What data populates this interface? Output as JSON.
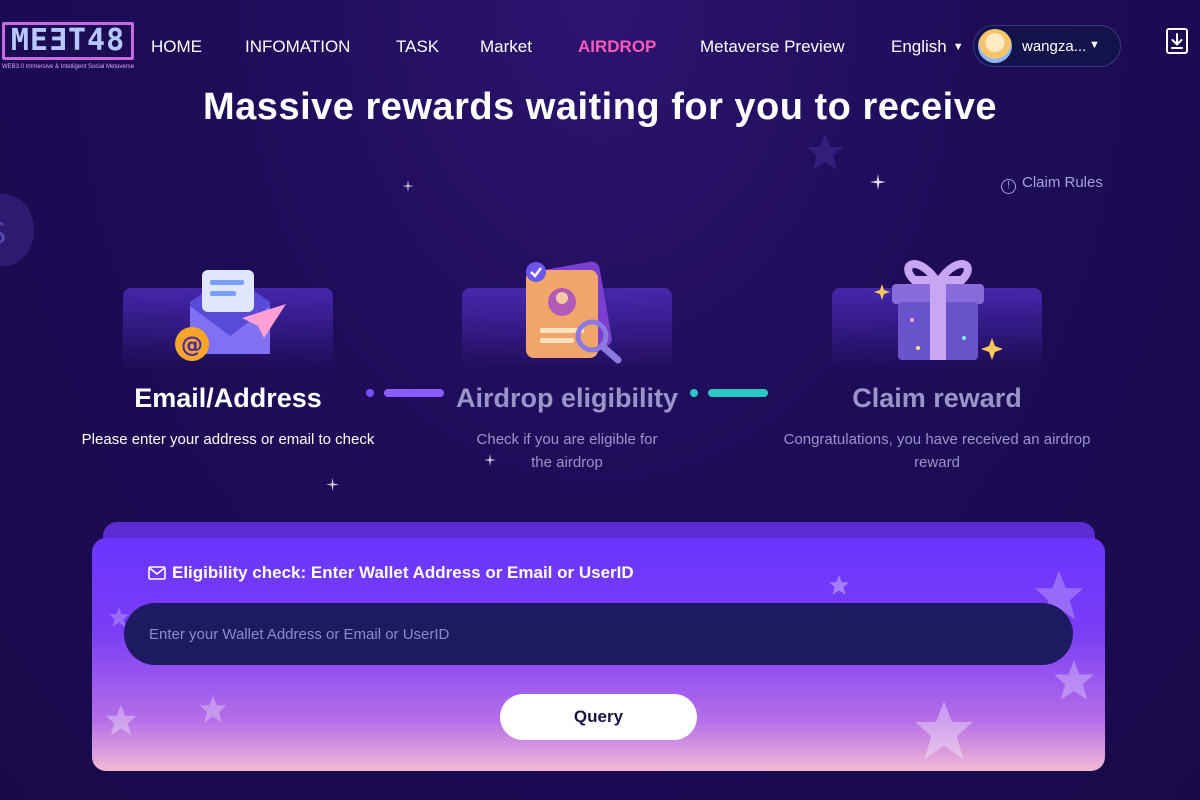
{
  "header": {
    "logo_text": "MEƎT48",
    "logo_tagline": "WEB3.0 Immersive & Intelligent Social Metaverse",
    "nav": [
      {
        "label": "HOME"
      },
      {
        "label": "INFOMATION"
      },
      {
        "label": "TASK"
      },
      {
        "label": "Market"
      },
      {
        "label": "AIRDROP",
        "active": true
      },
      {
        "label": "Metaverse Preview"
      }
    ],
    "language": "English",
    "username": "wangza..."
  },
  "hero": {
    "title": "Massive rewards waiting for you to receive",
    "claim_rules": "Claim Rules"
  },
  "steps": [
    {
      "title": "Email/Address",
      "desc": "Please enter your address or email to check",
      "active": true
    },
    {
      "title": "Airdrop eligibility",
      "desc": "Check if you are eligible for the airdrop",
      "active": false
    },
    {
      "title": "Claim reward",
      "desc": "Congratulations, you have received an airdrop reward",
      "active": false
    }
  ],
  "query": {
    "label": "Eligibility check: Enter Wallet Address or Email or UserID",
    "placeholder": "Enter your Wallet Address or Email or UserID",
    "value": "",
    "button": "Query"
  },
  "colors": {
    "accent_pink": "#ff5ab9",
    "bg_dark": "#1e0c58",
    "card_purple": "#6a36ff",
    "connector_purple": "#8a5cff",
    "connector_teal": "#2cc7c4",
    "inactive_text": "#9a94c8"
  },
  "icons": {
    "dropdown": "chevron-down-icon",
    "download": "download-icon",
    "info": "info-icon",
    "mail": "mail-icon"
  }
}
